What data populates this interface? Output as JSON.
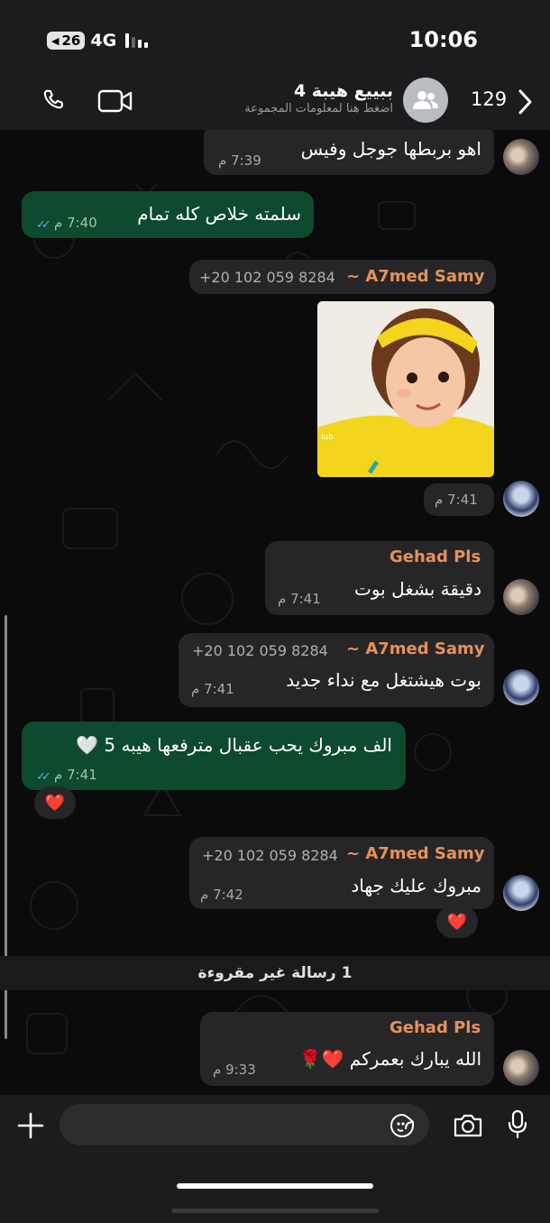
{
  "status": {
    "battery": "26",
    "network": "4G",
    "time": "10:06"
  },
  "header": {
    "group_name": "ببييع هيبة 4",
    "subtitle": "اضغط هنا لمعلومات المجموعة",
    "member_count": "129"
  },
  "messages": [
    {
      "text": "اهو بربطها جوجل وفيس",
      "time": "7:39 م"
    },
    {
      "text": "سلمته خلاص كله تمام",
      "time": "7:40 م"
    },
    {
      "sender": "~ A7med Samy",
      "phone": "+20 102 059 8284",
      "time": "7:41 م",
      "image": "photo-of-child"
    },
    {
      "sender": "Gehad Pls",
      "text": "دقيقة بشغل بوت",
      "time": "7:41 م"
    },
    {
      "sender": "~ A7med Samy",
      "phone": "+20 102 059 8284",
      "text": "بوت هيشتغل مع نداء جديد",
      "time": "7:41 م"
    },
    {
      "text": "الف مبروك يحب عقبال مترفعها هيبه 5 🤍",
      "time": "7:41 م",
      "reaction": "❤️"
    },
    {
      "sender": "~ A7med Samy",
      "phone": "+20 102 059 8284",
      "text": "مبروك عليك جهاد",
      "time": "7:42 م",
      "reaction": "❤️"
    },
    {
      "sender": "Gehad Pls",
      "text": "الله يبارك بعمركم ❤️🌹",
      "time": "9:33 م"
    }
  ],
  "unread_separator": "1 رسالة غير مقروءة",
  "photo_caption": "lub",
  "colors": {
    "outgoing_bubble": "#0d4a2e",
    "incoming_bubble": "#262628",
    "sender_name": "#e8915a",
    "read_ticks": "#4fb3e8"
  },
  "icons": [
    "phone-icon",
    "video-icon",
    "group-icon",
    "chevron-right-icon",
    "plus-icon",
    "sticker-icon",
    "camera-icon",
    "mic-icon"
  ]
}
